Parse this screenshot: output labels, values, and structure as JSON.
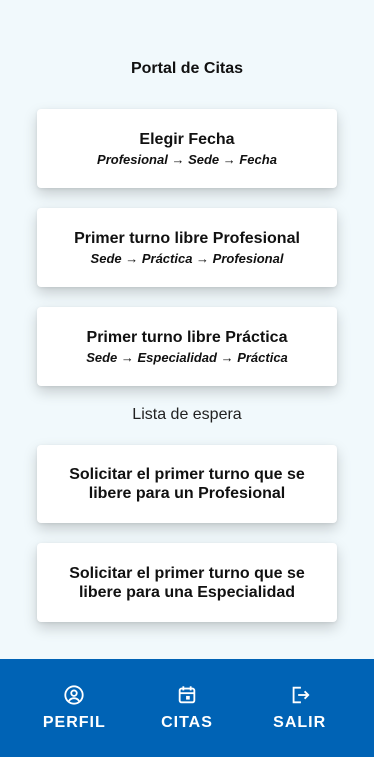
{
  "header": {
    "title": "Portal de Citas"
  },
  "cards": [
    {
      "title": "Elegir Fecha",
      "subtitle": "Profesional → Sede → Fecha"
    },
    {
      "title": "Primer turno libre Profesional",
      "subtitle": "Sede → Práctica → Profesional"
    },
    {
      "title": "Primer turno libre Práctica",
      "subtitle": "Sede → Especialidad → Práctica"
    }
  ],
  "waitlist": {
    "heading": "Lista de espera",
    "items": [
      {
        "title": "Solicitar el primer turno que se libere para un Profesional"
      },
      {
        "title": "Solicitar el primer turno que se libere para una Especialidad"
      }
    ]
  },
  "nav": {
    "items": [
      {
        "label": "PERFIL",
        "icon": "user-circle-icon"
      },
      {
        "label": "CITAS",
        "icon": "calendar-icon"
      },
      {
        "label": "SALIR",
        "icon": "logout-icon"
      }
    ]
  },
  "colors": {
    "nav_bg": "#0063b5",
    "page_bg": "#f1f9fc"
  }
}
